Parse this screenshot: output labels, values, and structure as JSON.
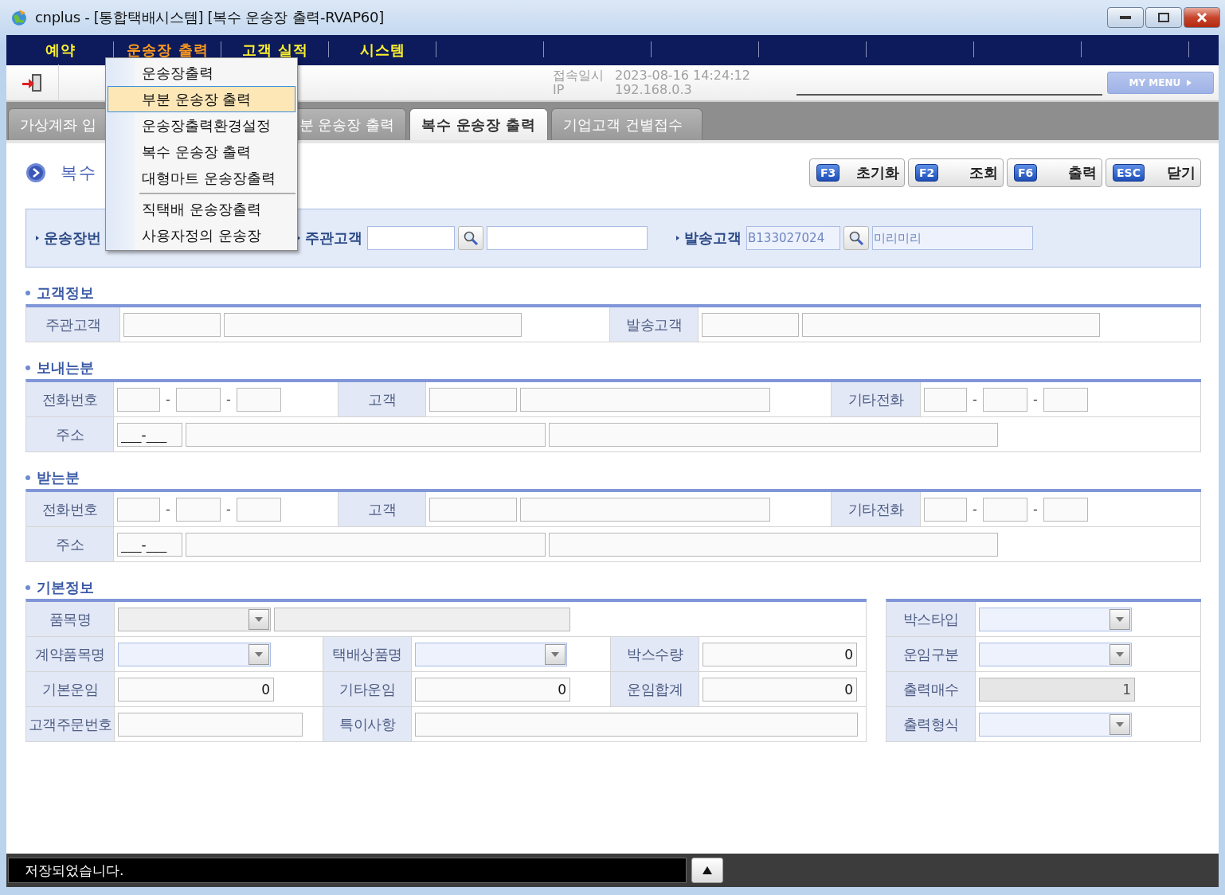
{
  "window": {
    "title": "cnplus - [통합택배시스템] [복수 운송장 출력-RVAP60]"
  },
  "menu_bar": [
    {
      "label": "예약",
      "selected": false
    },
    {
      "label": "운송장 출력",
      "selected": true
    },
    {
      "label": "고객 실적",
      "selected": false
    },
    {
      "label": "시스템",
      "selected": false
    }
  ],
  "dropdown": {
    "groups": [
      [
        {
          "label": "운송장출력",
          "selected": false
        },
        {
          "label": "부분 운송장 출력",
          "selected": true
        },
        {
          "label": "운송장출력환경설정",
          "selected": false
        },
        {
          "label": "복수 운송장 출력",
          "selected": false
        },
        {
          "label": "대형마트 운송장출력",
          "selected": false
        }
      ],
      [
        {
          "label": "직택배 운송장출력",
          "selected": false
        },
        {
          "label": "사용자정의 운송장",
          "selected": false
        }
      ]
    ]
  },
  "toolbar": {
    "login_label": "접속일시",
    "login_time": "2023-08-16 14:24:12",
    "ip_label": "IP",
    "ip": "192.168.0.3",
    "my_menu": "MY MENU"
  },
  "tabs": [
    {
      "label": "가상계좌 입",
      "selected": false
    },
    {
      "label": "분 운송장 출력",
      "selected": false
    },
    {
      "label": "복수 운송장 출력",
      "selected": true
    },
    {
      "label": "기업고객 건별접수",
      "selected": false
    }
  ],
  "page_title": "복수",
  "actions": [
    {
      "key": "F3",
      "label": "초기화"
    },
    {
      "key": "F2",
      "label": "조회"
    },
    {
      "key": "F6",
      "label": "출력"
    },
    {
      "key": "ESC",
      "label": "닫기"
    }
  ],
  "search": {
    "waybill_label": "운송장번",
    "main_customer": {
      "label": "주관고객"
    },
    "sender": {
      "label": "발송고객",
      "code": "B133027024",
      "name": "미리미리"
    }
  },
  "customer_info": {
    "title": "고객정보",
    "main_customer_label": "주관고객",
    "sender_label": "발송고객"
  },
  "sender": {
    "title": "보내는분",
    "phone_label": "전화번호",
    "phone_separators": [
      "-",
      "-"
    ],
    "customer_label": "고객",
    "other_phone_label": "기타전화",
    "other_phone_separators": [
      "-",
      "-"
    ],
    "address_label": "주소",
    "postcode": "___-___"
  },
  "receiver": {
    "title": "받는분",
    "phone_label": "전화번호",
    "phone_separators": [
      "-",
      "-"
    ],
    "customer_label": "고객",
    "other_phone_label": "기타전화",
    "other_phone_separators": [
      "-",
      "-"
    ],
    "address_label": "주소",
    "postcode": "___-___"
  },
  "basic_info": {
    "title": "기본정보",
    "item_name": {
      "label": "품목명",
      "disabled": true
    },
    "contract_item": {
      "label": "계약품목명",
      "disabled": false
    },
    "product": {
      "label": "택배상품명",
      "disabled": false
    },
    "box_qty": {
      "label": "박스수량",
      "value": "0"
    },
    "base_fare": {
      "label": "기본운임",
      "value": "0"
    },
    "other_fare": {
      "label": "기타운임",
      "value": "0"
    },
    "total_fare": {
      "label": "운임합계",
      "value": "0"
    },
    "order_no": {
      "label": "고객주문번호"
    },
    "notes": {
      "label": "특이사항"
    },
    "box_type": {
      "label": "박스타입",
      "disabled": false
    },
    "fare_type": {
      "label": "운임구분",
      "disabled": false
    },
    "print_count": {
      "label": "출력매수",
      "value": "1",
      "disabled": true
    },
    "print_format": {
      "label": "출력형식",
      "disabled": false
    }
  },
  "status": {
    "message": "저장되었습니다."
  }
}
